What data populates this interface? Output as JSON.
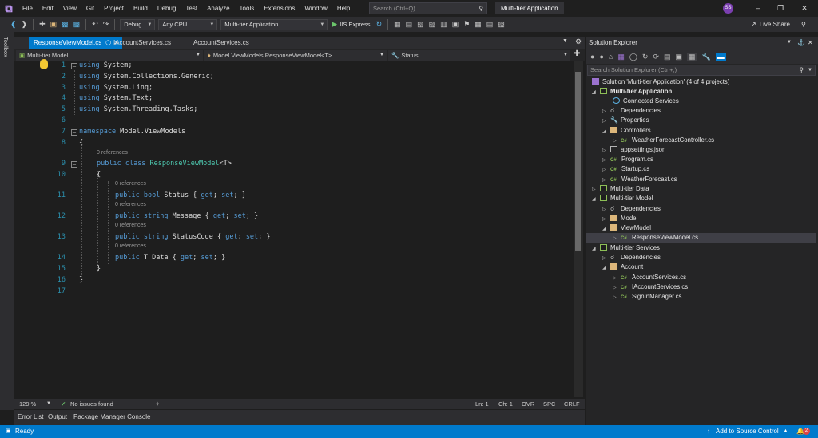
{
  "titlebar": {
    "menu": [
      "File",
      "Edit",
      "View",
      "Git",
      "Project",
      "Build",
      "Debug",
      "Test",
      "Analyze",
      "Tools",
      "Extensions",
      "Window",
      "Help"
    ],
    "search_placeholder": "Search (Ctrl+Q)",
    "app_title": "Multi-tier Application",
    "avatar": "SS"
  },
  "toolbar": {
    "config": "Debug",
    "platform": "Any CPU",
    "startup": "Multi-tier Application",
    "run_label": "IIS Express",
    "live_share": "Live Share"
  },
  "sidebar_toolbox": "Toolbox",
  "tabs": [
    {
      "label": "ResponseViewModel.cs",
      "active": true
    },
    {
      "label": "IAccountServices.cs",
      "active": false
    },
    {
      "label": "AccountServices.cs",
      "active": false
    }
  ],
  "navbar": {
    "project": "Multi-tier Model",
    "type": "Model.ViewModels.ResponseViewModel<T>",
    "member": "Status"
  },
  "code": {
    "refs": "0 references",
    "lines": [
      "1",
      "2",
      "3",
      "4",
      "5",
      "6",
      "7",
      "8",
      "9",
      "10",
      "11",
      "12",
      "13",
      "14",
      "15",
      "16",
      "17"
    ],
    "using": "using",
    "l1": " System;",
    "l2": " System.Collections.Generic;",
    "l3": " System.Linq;",
    "l4": " System.Text;",
    "l5": " System.Threading.Tasks;",
    "namespace_kw": "namespace",
    "namespace_name": " Model.ViewModels",
    "open_brace": "{",
    "close_brace": "}",
    "public": "public",
    "class_kw": " class ",
    "class_name": "ResponseViewModel",
    "generic": "<T>",
    "bool": " bool",
    "string": " string",
    "prop_status": " Status { ",
    "prop_message": " Message { ",
    "prop_statuscode": " StatusCode { ",
    "prop_data": " T Data { ",
    "get": "get",
    "set": "set",
    "semi": "; ",
    "end": "; }"
  },
  "editor_status": {
    "zoom": "129 %",
    "issues": "No issues found",
    "line": "Ln: 1",
    "col": "Ch: 1",
    "ovr": "OVR",
    "spc": "SPC",
    "crlf": "CRLF"
  },
  "bottom_tabs": [
    "Error List",
    "Output",
    "Package Manager Console"
  ],
  "statusbar": {
    "ready": "Ready",
    "source_control": "Add to Source Control",
    "notifications": "2"
  },
  "solution_explorer": {
    "title": "Solution Explorer",
    "search_placeholder": "Search Solution Explorer (Ctrl+;)",
    "items": [
      {
        "label": "Solution 'Multi-tier Application' (4 of 4 projects)",
        "icon": "solution-icon",
        "bold": false
      },
      {
        "label": "Multi-tier Application",
        "icon": "project-icon",
        "bold": true
      },
      {
        "label": "Connected Services",
        "icon": "connected-services-icon"
      },
      {
        "label": "Dependencies",
        "icon": "dependencies-icon"
      },
      {
        "label": "Properties",
        "icon": "properties-icon"
      },
      {
        "label": "Controllers",
        "icon": "folder-icon"
      },
      {
        "label": "WeatherForecastController.cs",
        "icon": "csharp-file-icon"
      },
      {
        "label": "appsettings.json",
        "icon": "json-file-icon"
      },
      {
        "label": "Program.cs",
        "icon": "csharp-file-icon"
      },
      {
        "label": "Startup.cs",
        "icon": "csharp-file-icon"
      },
      {
        "label": "WeatherForecast.cs",
        "icon": "csharp-file-icon"
      },
      {
        "label": "Multi-tier Data",
        "icon": "project-icon"
      },
      {
        "label": "Multi-tier Model",
        "icon": "project-icon"
      },
      {
        "label": "Dependencies",
        "icon": "dependencies-icon"
      },
      {
        "label": "Model",
        "icon": "folder-icon"
      },
      {
        "label": "ViewModel",
        "icon": "folder-icon"
      },
      {
        "label": "ResponseViewModel.cs",
        "icon": "csharp-file-icon"
      },
      {
        "label": "Multi-tier Services",
        "icon": "project-icon"
      },
      {
        "label": "Dependencies",
        "icon": "dependencies-icon"
      },
      {
        "label": "Account",
        "icon": "folder-icon"
      },
      {
        "label": "AccountServices.cs",
        "icon": "csharp-file-icon"
      },
      {
        "label": "IAccountServices.cs",
        "icon": "csharp-file-icon"
      },
      {
        "label": "SignInManager.cs",
        "icon": "csharp-file-icon"
      }
    ]
  },
  "colors": {
    "accent": "#007acc",
    "keyword": "#569cd6",
    "type": "#4ec9b0",
    "line_number": "#2b91af"
  }
}
